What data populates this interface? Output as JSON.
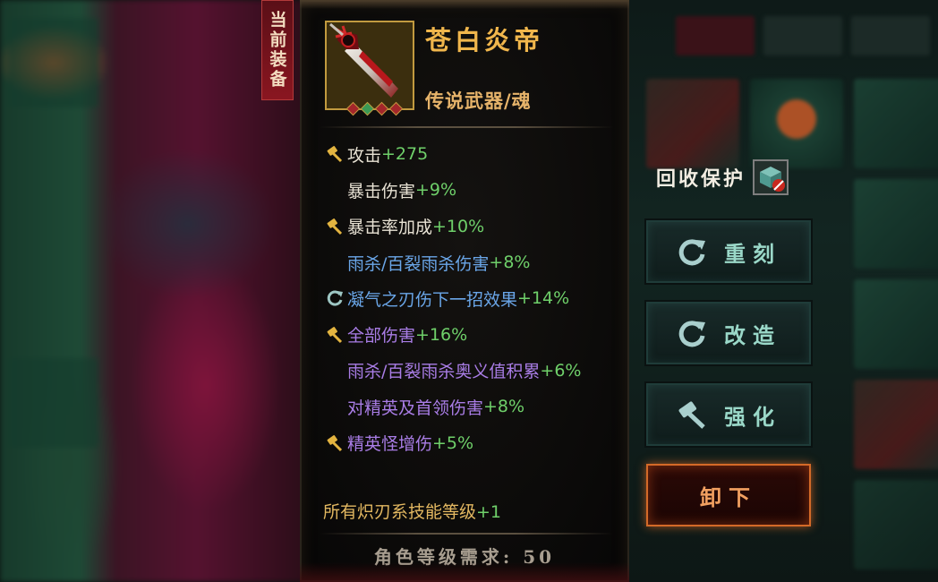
{
  "current_equipment_tag": "当前装备",
  "item": {
    "name": "苍白炎帝",
    "type": "传说武器/魂",
    "icon": "crimson-greatsword-icon",
    "gems": [
      "#a3262a",
      "#3b9a55",
      "#a3262a",
      "#a3262a"
    ]
  },
  "stats": [
    {
      "icon": "hammer-icon",
      "label": "攻击",
      "value": "+275",
      "label_color": "white"
    },
    {
      "icon": null,
      "label": "暴击伤害",
      "value": "+9%",
      "label_color": "white"
    },
    {
      "icon": "hammer-icon",
      "label": "暴击率加成",
      "value": "+10%",
      "label_color": "white"
    },
    {
      "icon": null,
      "label": "雨杀/百裂雨杀伤害",
      "value": "+8%",
      "label_color": "blue"
    },
    {
      "icon": "refresh-icon",
      "label": "凝气之刃伤下一招效果",
      "value": "+14%",
      "label_color": "blue"
    },
    {
      "icon": "hammer-icon",
      "label": "全部伤害",
      "value": "+16%",
      "label_color": "purple"
    },
    {
      "icon": null,
      "label": "雨杀/百裂雨杀奥义值积累",
      "value": "+6%",
      "label_color": "purple"
    },
    {
      "icon": null,
      "label": "对精英及首领伤害",
      "value": "+8%",
      "label_color": "purple"
    },
    {
      "icon": "hammer-icon",
      "label": "精英怪增伤",
      "value": "+5%",
      "label_color": "purple"
    }
  ],
  "skill_bonus": {
    "label": "所有炽刃系技能等级",
    "value": "+1"
  },
  "requirement": "角色等级需求: 50",
  "recycle_protect": {
    "label": "回收保护",
    "icon": "recycle-protect-toggle-icon"
  },
  "buttons": {
    "reforge": "重刻",
    "modify": "改造",
    "enhance": "强化",
    "unequip": "卸下"
  },
  "colors": {
    "name": "#f0b64c",
    "stat_value": "#6fd06a",
    "stat_blue": "#6aa6e8",
    "stat_purple": "#a97de6",
    "unequip_border": "#d46a28"
  }
}
